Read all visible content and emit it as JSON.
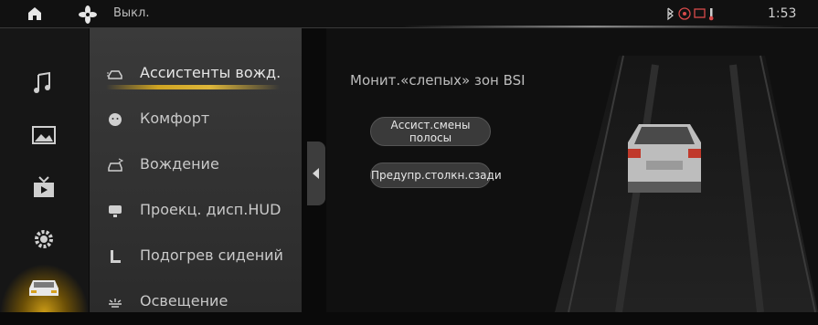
{
  "statusbar": {
    "fan_status": "Выкл.",
    "time": "1:53",
    "icons": [
      "home-icon",
      "fan-icon",
      "bluetooth-icon",
      "gps-icon",
      "message-icon",
      "thermometer-icon"
    ]
  },
  "left_rail": {
    "items": [
      {
        "icon": "music-note-icon",
        "active": false
      },
      {
        "icon": "photo-icon",
        "active": false
      },
      {
        "icon": "video-icon",
        "active": false
      },
      {
        "icon": "gear-icon",
        "active": false
      },
      {
        "icon": "car-icon",
        "active": true
      }
    ]
  },
  "menu": {
    "items": [
      {
        "label": "Ассистенты вожд.",
        "icon": "car-assist-icon",
        "active": true
      },
      {
        "label": "Комфорт",
        "icon": "face-icon",
        "active": false
      },
      {
        "label": "Вождение",
        "icon": "steering-icon",
        "active": false
      },
      {
        "label": "Проекц. дисп.HUD",
        "icon": "hud-icon",
        "active": false
      },
      {
        "label": "Подогрев сидений",
        "icon": "seat-heat-icon",
        "active": false
      },
      {
        "label": "Освещение",
        "icon": "light-icon",
        "active": false
      }
    ]
  },
  "main": {
    "title": "Монит.«слепых» зон BSI",
    "buttons": [
      {
        "line1": "Ассист.смены",
        "line2": "полосы"
      },
      {
        "line1": "Предупр.столкн.сзади",
        "line2": ""
      }
    ]
  },
  "colors": {
    "accent": "#e0b020",
    "panel": "#2f2f2f",
    "background": "#101010"
  }
}
